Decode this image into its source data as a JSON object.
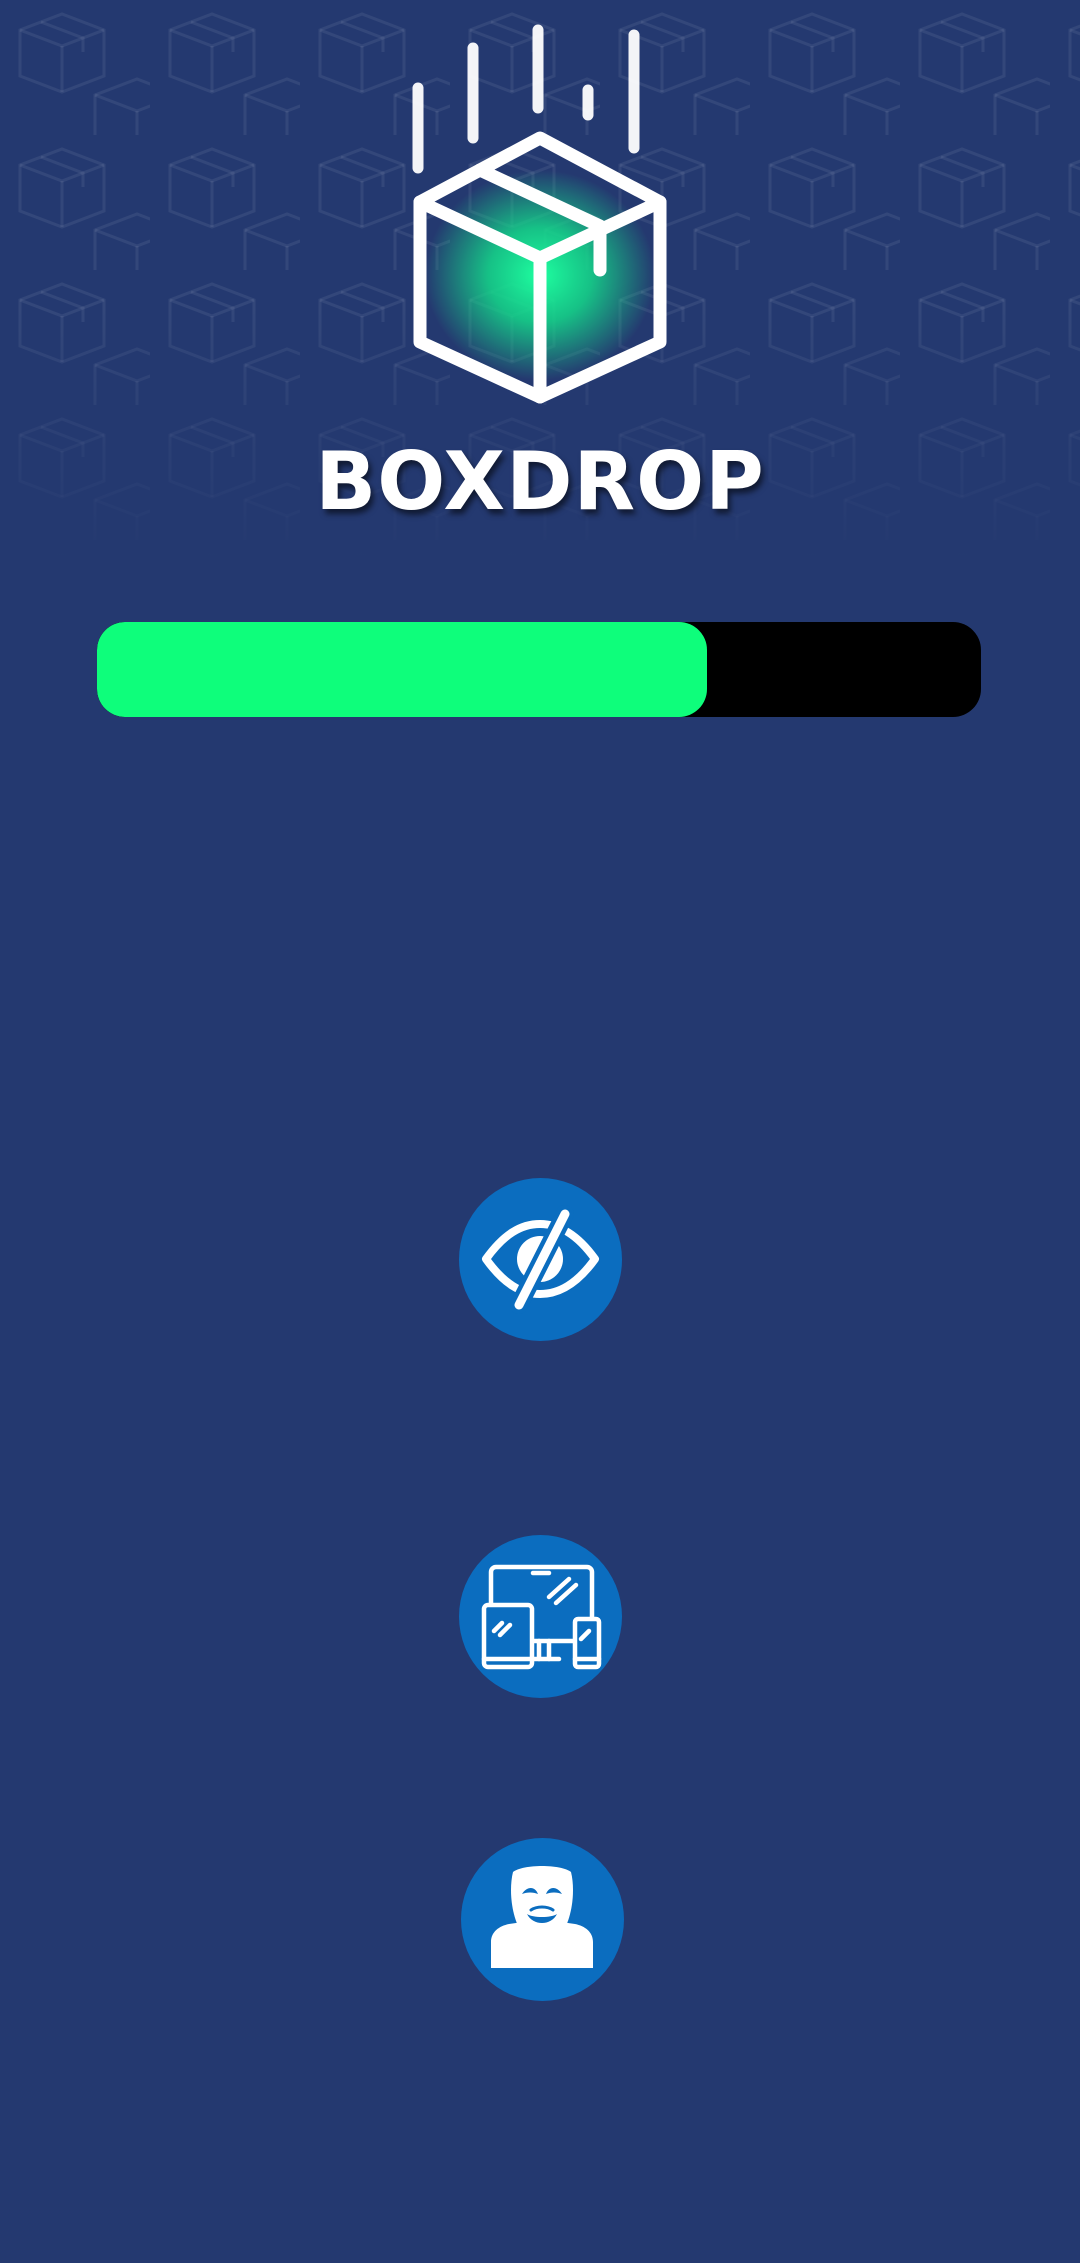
{
  "app": {
    "brand_name": "BOXDROP"
  },
  "loading": {
    "progress_percent": 69
  },
  "features": [
    {
      "icon": "eye-slash-icon"
    },
    {
      "icon": "multi-device-icon"
    },
    {
      "icon": "anonymous-mask-icon"
    }
  ],
  "colors": {
    "background": "#243970",
    "progress_fill": "#0efe7b",
    "progress_track": "#000000",
    "feature_circle": "#0b6dbf",
    "logo_glow": "#1effa0"
  }
}
